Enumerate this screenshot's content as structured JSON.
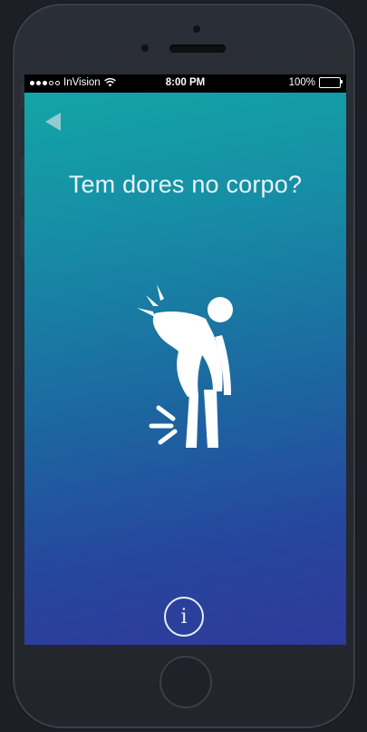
{
  "status_bar": {
    "carrier": "InVision",
    "time": "8:00 PM",
    "battery": "100%",
    "battery_level": 1.0
  },
  "screen": {
    "title": "Tem dores no corpo?",
    "info_label": "i"
  },
  "icons": {
    "back": "back-arrow-icon",
    "illustration": "body-pain-icon",
    "info": "info-icon"
  },
  "colors": {
    "gradient_top": "#13a5a5",
    "gradient_bottom": "#2e3a99",
    "text": "#e9f4f7"
  }
}
